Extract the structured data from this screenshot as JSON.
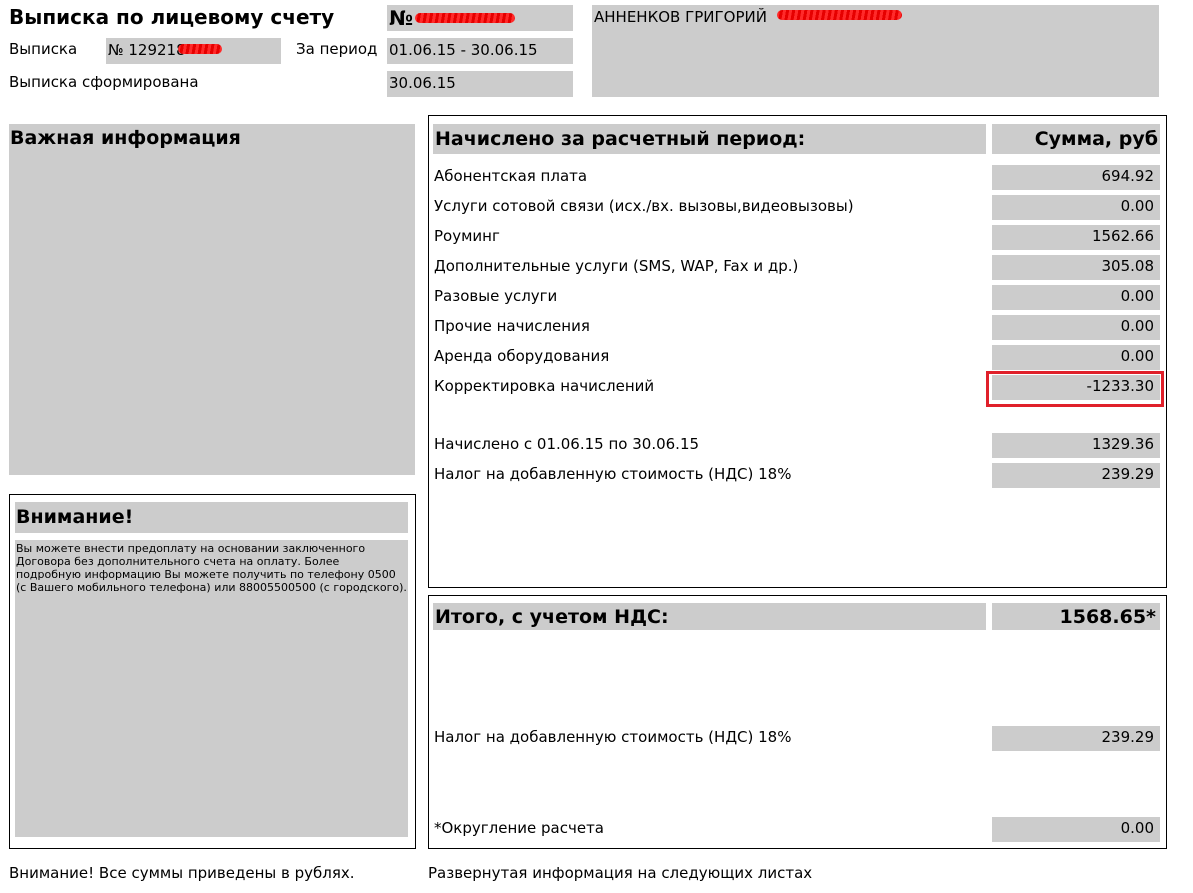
{
  "header": {
    "title": "Выписка по лицевому счету",
    "number_prefix": "№",
    "client_name": "АННЕНКОВ ГРИГОРИЙ",
    "statement_label": "Выписка",
    "statement_number": "№ 129218",
    "period_label": "За период",
    "period_value": "01.06.15 - 30.06.15",
    "formed_label": "Выписка сформирована",
    "formed_value": "30.06.15"
  },
  "important": {
    "title": "Важная информация"
  },
  "attention": {
    "title": "Внимание!",
    "text": "Вы можете внести предоплату на основании заключенного Договора без дополнительного счета на оплату. Более подробную информацию Вы можете получить по телефону 0500 (с Вашего мобильного телефона) или 88005500500 (с городского)."
  },
  "charges": {
    "title": "Начислено за расчетный период:",
    "sum_header": "Сумма, руб",
    "rows": [
      {
        "label": "Абонентская плата",
        "value": "694.92"
      },
      {
        "label": "Услуги сотовой связи (исх./вх. вызовы,видеовызовы)",
        "value": "0.00"
      },
      {
        "label": "Роуминг",
        "value": "1562.66"
      },
      {
        "label": "Дополнительные услуги (SMS, WAP, Fax и др.)",
        "value": "305.08"
      },
      {
        "label": "Разовые услуги",
        "value": "0.00"
      },
      {
        "label": "Прочие начисления",
        "value": "0.00"
      },
      {
        "label": "Аренда оборудования",
        "value": "0.00"
      },
      {
        "label": "Корректировка начислений",
        "value": "-1233.30"
      }
    ],
    "accrued_label": "Начислено с 01.06.15 по 30.06.15",
    "accrued_value": "1329.36",
    "vat_label": "Налог на добавленную стоимость (НДС) 18%",
    "vat_value": "239.29"
  },
  "total": {
    "title": "Итого, с учетом НДС:",
    "value": "1568.65*",
    "vat_label": "Налог на добавленную стоимость (НДС) 18%",
    "vat_value": "239.29",
    "rounding_label": "*Округление расчета",
    "rounding_value": "0.00"
  },
  "footer": {
    "left": "Внимание! Все суммы приведены в рублях.",
    "right": "Развернутая информация на следующих листах"
  },
  "colors": {
    "cell_gray": "#cccccc",
    "highlight_red": "#e0202a",
    "redaction_red": "#ff2a2a"
  }
}
